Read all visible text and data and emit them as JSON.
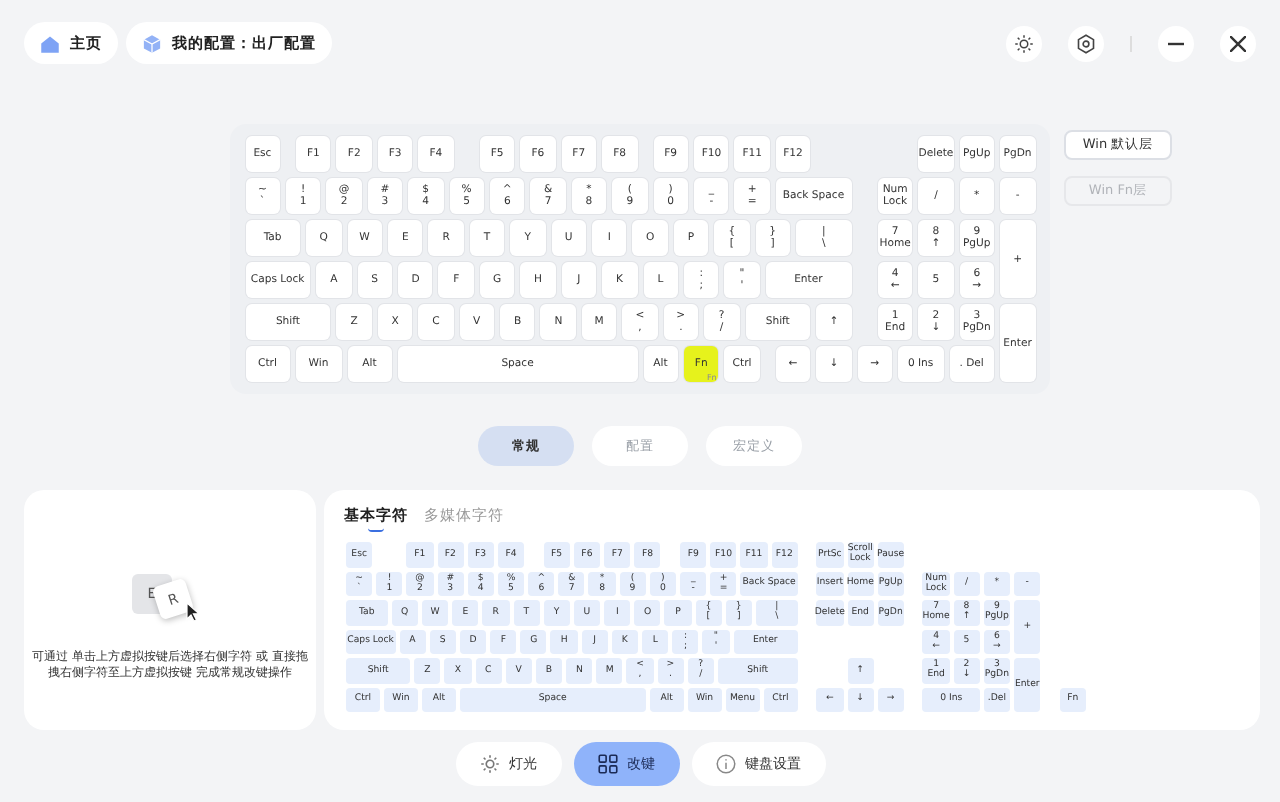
{
  "top_bar": {
    "home": "主页",
    "profile": "我的配置：出厂配置"
  },
  "keyboard": {
    "rows": [
      {
        "keys": [
          {
            "label": "Esc",
            "selected": false
          },
          {
            "label": "F1",
            "selected": false
          },
          {
            "label": "F2",
            "selected": false
          },
          {
            "label": "F3",
            "selected": false
          },
          {
            "label": "F4",
            "selected": false
          },
          {
            "label": "F5",
            "selected": false
          },
          {
            "label": "F6",
            "selected": false
          },
          {
            "label": "F7",
            "selected": false
          },
          {
            "label": "F8",
            "selected": false
          },
          {
            "label": "F9",
            "selected": false
          },
          {
            "label": "F10",
            "selected": false
          },
          {
            "label": "F11",
            "selected": false
          },
          {
            "label": "F12",
            "selected": false
          },
          {
            "label": "Delete",
            "selected": false
          },
          {
            "label": "PgUp",
            "selected": false
          },
          {
            "label": "PgDn",
            "selected": false
          }
        ]
      },
      {
        "keys": [
          {
            "upper": "~",
            "label": "`",
            "selected": false
          },
          {
            "upper": "!",
            "label": "1",
            "selected": false
          },
          {
            "upper": "@",
            "label": "2",
            "selected": false
          },
          {
            "upper": "#",
            "label": "3",
            "selected": false
          },
          {
            "upper": "$",
            "label": "4",
            "selected": false
          },
          {
            "upper": "%",
            "label": "5",
            "selected": false
          },
          {
            "upper": "^",
            "label": "6",
            "selected": false
          },
          {
            "upper": "&",
            "label": "7",
            "selected": false
          },
          {
            "upper": "*",
            "label": "8",
            "selected": false
          },
          {
            "upper": "(",
            "label": "9",
            "selected": false
          },
          {
            "upper": ")",
            "label": "0",
            "selected": false
          },
          {
            "upper": "_",
            "label": "-",
            "selected": false
          },
          {
            "upper": "+",
            "label": "=",
            "selected": false
          },
          {
            "label": "Back Space",
            "selected": false
          },
          {
            "label": "Num Lock",
            "selected": false
          },
          {
            "label": "/",
            "selected": false
          },
          {
            "label": "*",
            "selected": false
          },
          {
            "label": "-",
            "selected": false
          }
        ]
      },
      {
        "keys": [
          {
            "label": "Tab",
            "selected": false
          },
          {
            "label": "Q",
            "selected": false
          },
          {
            "label": "W",
            "selected": false
          },
          {
            "label": "E",
            "selected": false
          },
          {
            "label": "R",
            "selected": false
          },
          {
            "label": "T",
            "selected": false
          },
          {
            "label": "Y",
            "selected": false
          },
          {
            "label": "U",
            "selected": false
          },
          {
            "label": "I",
            "selected": false
          },
          {
            "label": "O",
            "selected": false
          },
          {
            "label": "P",
            "selected": false
          },
          {
            "upper": "{",
            "label": "[",
            "selected": false
          },
          {
            "upper": "}",
            "label": "]",
            "selected": false
          },
          {
            "upper": "|",
            "label": "\\",
            "selected": false
          },
          {
            "upper": "7",
            "label": "Home",
            "selected": false
          },
          {
            "upper": "8",
            "label": "↑",
            "selected": false
          },
          {
            "upper": "9",
            "label": "PgUp",
            "selected": false
          },
          {
            "label": "+",
            "selected": false
          }
        ]
      },
      {
        "keys": [
          {
            "label": "Caps Lock",
            "selected": false
          },
          {
            "label": "A",
            "selected": false
          },
          {
            "label": "S",
            "selected": false
          },
          {
            "label": "D",
            "selected": false
          },
          {
            "label": "F",
            "selected": false
          },
          {
            "label": "G",
            "selected": false
          },
          {
            "label": "H",
            "selected": false
          },
          {
            "label": "J",
            "selected": false
          },
          {
            "label": "K",
            "selected": false
          },
          {
            "label": "L",
            "selected": false
          },
          {
            "upper": ":",
            "label": ";",
            "selected": false
          },
          {
            "upper": "\"",
            "label": "'",
            "selected": false
          },
          {
            "label": "Enter",
            "selected": false
          },
          {
            "upper": "4",
            "label": "←",
            "selected": false
          },
          {
            "label": "5",
            "selected": false
          },
          {
            "upper": "6",
            "label": "→",
            "selected": false
          }
        ]
      },
      {
        "keys": [
          {
            "label": "Shift",
            "selected": false
          },
          {
            "label": "Z",
            "selected": false
          },
          {
            "label": "X",
            "selected": false
          },
          {
            "label": "C",
            "selected": false
          },
          {
            "label": "V",
            "selected": false
          },
          {
            "label": "B",
            "selected": false
          },
          {
            "label": "N",
            "selected": false
          },
          {
            "label": "M",
            "selected": false
          },
          {
            "upper": "<",
            "label": ",",
            "selected": false
          },
          {
            "upper": ">",
            "label": ".",
            "selected": false
          },
          {
            "upper": "?",
            "label": "/",
            "selected": false
          },
          {
            "label": "Shift",
            "selected": false
          },
          {
            "label": "↑",
            "selected": false
          },
          {
            "upper": "1",
            "label": "End",
            "selected": false
          },
          {
            "upper": "2",
            "label": "↓",
            "selected": false
          },
          {
            "upper": "3",
            "label": "PgDn",
            "selected": false
          },
          {
            "label": "Enter",
            "selected": false
          }
        ]
      },
      {
        "keys": [
          {
            "label": "Ctrl",
            "selected": false
          },
          {
            "label": "Win",
            "selected": false
          },
          {
            "label": "Alt",
            "selected": false
          },
          {
            "label": "Space",
            "selected": false
          },
          {
            "label": "Alt",
            "selected": false
          },
          {
            "label": "Fn",
            "corner": "Fn",
            "selected": true
          },
          {
            "label": "Ctrl",
            "selected": false
          },
          {
            "label": "←",
            "selected": false
          },
          {
            "label": "↓",
            "selected": false
          },
          {
            "label": "→",
            "selected": false
          },
          {
            "label": "0 Ins",
            "selected": false
          },
          {
            "label": ". Del",
            "selected": false
          }
        ]
      }
    ]
  },
  "layers": [
    {
      "label": "Win 默认层",
      "selected": true
    },
    {
      "label": "Win Fn层",
      "selected": false
    }
  ],
  "mode_tabs": [
    {
      "label": "常规",
      "selected": true
    },
    {
      "label": "配置",
      "selected": false
    },
    {
      "label": "宏定义",
      "selected": false
    }
  ],
  "hint": {
    "keys": [
      "E",
      "R"
    ],
    "text": "可通过 单击上方虚拟按键后选择右侧字符 或 直接拖拽右侧字符至上方虚拟按键 完成常规改键操作"
  },
  "char_tabs": [
    {
      "label": "基本字符",
      "selected": true
    },
    {
      "label": "多媒体字符",
      "selected": false
    }
  ],
  "char_keyboard": {
    "rows": [
      {
        "keys": [
          {
            "label": "Esc"
          },
          {
            "label": "F1"
          },
          {
            "label": "F2"
          },
          {
            "label": "F3"
          },
          {
            "label": "F4"
          },
          {
            "label": "F5"
          },
          {
            "label": "F6"
          },
          {
            "label": "F7"
          },
          {
            "label": "F8"
          },
          {
            "label": "F9"
          },
          {
            "label": "F10"
          },
          {
            "label": "F11"
          },
          {
            "label": "F12"
          },
          {
            "label": "PrtSc"
          },
          {
            "label": "Scroll Lock"
          },
          {
            "label": "Pause"
          }
        ]
      },
      {
        "keys": [
          {
            "upper": "~",
            "label": "`"
          },
          {
            "upper": "!",
            "label": "1"
          },
          {
            "upper": "@",
            "label": "2"
          },
          {
            "upper": "#",
            "label": "3"
          },
          {
            "upper": "$",
            "label": "4"
          },
          {
            "upper": "%",
            "label": "5"
          },
          {
            "upper": "^",
            "label": "6"
          },
          {
            "upper": "&",
            "label": "7"
          },
          {
            "upper": "*",
            "label": "8"
          },
          {
            "upper": "(",
            "label": "9"
          },
          {
            "upper": ")",
            "label": "0"
          },
          {
            "upper": "_",
            "label": "-"
          },
          {
            "upper": "+",
            "label": "="
          },
          {
            "label": "Back Space"
          },
          {
            "label": "Insert"
          },
          {
            "label": "Home"
          },
          {
            "label": "PgUp"
          },
          {
            "label": "Num Lock"
          },
          {
            "label": "/"
          },
          {
            "label": "*"
          },
          {
            "label": "-"
          }
        ]
      },
      {
        "keys": [
          {
            "label": "Tab"
          },
          {
            "label": "Q"
          },
          {
            "label": "W"
          },
          {
            "label": "E"
          },
          {
            "label": "R"
          },
          {
            "label": "T"
          },
          {
            "label": "Y"
          },
          {
            "label": "U"
          },
          {
            "label": "I"
          },
          {
            "label": "O"
          },
          {
            "label": "P"
          },
          {
            "upper": "{",
            "label": "["
          },
          {
            "upper": "}",
            "label": "]"
          },
          {
            "upper": "|",
            "label": "\\"
          },
          {
            "label": "Delete"
          },
          {
            "label": "End"
          },
          {
            "label": "PgDn"
          },
          {
            "upper": "7",
            "label": "Home"
          },
          {
            "upper": "8",
            "label": "↑"
          },
          {
            "upper": "9",
            "label": "PgUp"
          },
          {
            "label": "+"
          }
        ]
      },
      {
        "keys": [
          {
            "label": "Caps Lock"
          },
          {
            "label": "A"
          },
          {
            "label": "S"
          },
          {
            "label": "D"
          },
          {
            "label": "F"
          },
          {
            "label": "G"
          },
          {
            "label": "H"
          },
          {
            "label": "J"
          },
          {
            "label": "K"
          },
          {
            "label": "L"
          },
          {
            "upper": ":",
            "label": ";"
          },
          {
            "upper": "\"",
            "label": "'"
          },
          {
            "label": "Enter"
          },
          {
            "upper": "4",
            "label": "←"
          },
          {
            "label": "5"
          },
          {
            "upper": "6",
            "label": "→"
          }
        ]
      },
      {
        "keys": [
          {
            "label": "Shift"
          },
          {
            "label": "Z"
          },
          {
            "label": "X"
          },
          {
            "label": "C"
          },
          {
            "label": "V"
          },
          {
            "label": "B"
          },
          {
            "label": "N"
          },
          {
            "label": "M"
          },
          {
            "upper": "<",
            "label": ","
          },
          {
            "upper": ">",
            "label": "."
          },
          {
            "upper": "?",
            "label": "/"
          },
          {
            "label": "Shift"
          },
          {
            "label": "↑"
          },
          {
            "upper": "1",
            "label": "End"
          },
          {
            "upper": "2",
            "label": "↓"
          },
          {
            "upper": "3",
            "label": "PgDn"
          },
          {
            "label": "Enter"
          }
        ]
      },
      {
        "keys": [
          {
            "label": "Ctrl"
          },
          {
            "label": "Win"
          },
          {
            "label": "Alt"
          },
          {
            "label": "Space"
          },
          {
            "label": "Alt"
          },
          {
            "label": "Win"
          },
          {
            "label": "Menu"
          },
          {
            "label": "Ctrl"
          },
          {
            "label": "←"
          },
          {
            "label": "↓"
          },
          {
            "label": "→"
          },
          {
            "label": "0 Ins"
          },
          {
            "label": ".Del"
          },
          {
            "label": "Fn"
          }
        ]
      }
    ]
  },
  "bottom_nav": [
    {
      "label": "灯光",
      "kind": "light",
      "selected": false
    },
    {
      "label": "改键",
      "kind": "remap",
      "selected": true
    },
    {
      "label": "键盘设置",
      "kind": "settings",
      "selected": false
    }
  ]
}
